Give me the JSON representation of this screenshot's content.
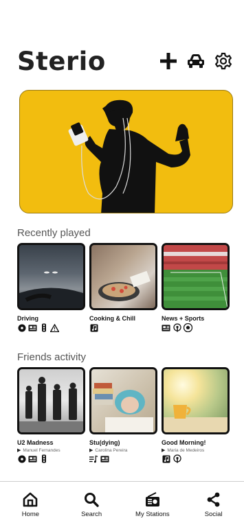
{
  "app": {
    "title": "Sterio"
  },
  "header": {
    "add_icon": "plus-icon",
    "car_icon": "car-icon",
    "settings_icon": "gear-icon"
  },
  "hero": {
    "bg_color": "#f2bd0f",
    "image": "silhouette-listening-music"
  },
  "recently_played": {
    "title": "Recently played",
    "items": [
      {
        "title": "Driving",
        "image": "night-driving",
        "tags": [
          "music-disc-icon",
          "news-icon",
          "traffic-light-icon",
          "warning-icon"
        ]
      },
      {
        "title": "Cooking & Chill",
        "image": "cooking",
        "tags": [
          "music-note-square-icon"
        ]
      },
      {
        "title": "News + Sports",
        "image": "stadium",
        "tags": [
          "news-icon",
          "podcast-icon",
          "soccer-ball-icon"
        ]
      }
    ]
  },
  "friends_activity": {
    "title": "Friends activity",
    "items": [
      {
        "title": "U2 Madness",
        "user": "Manuel Fernandes",
        "image": "band-photo",
        "tags": [
          "music-disc-icon",
          "news-icon",
          "traffic-light-icon"
        ]
      },
      {
        "title": "Stu(dying)",
        "user": "Carolina Pereira",
        "image": "studying",
        "tags": [
          "playlist-icon",
          "news-icon"
        ]
      },
      {
        "title": "Good Morning!",
        "user": "Maria de Medeiros",
        "image": "morning-cup",
        "tags": [
          "music-note-square-icon",
          "podcast-icon"
        ]
      }
    ]
  },
  "nav": {
    "items": [
      {
        "label": "Home",
        "icon": "home-icon"
      },
      {
        "label": "Search",
        "icon": "search-icon"
      },
      {
        "label": "My Stations",
        "icon": "radio-icon"
      },
      {
        "label": "Social",
        "icon": "share-icon"
      }
    ]
  }
}
